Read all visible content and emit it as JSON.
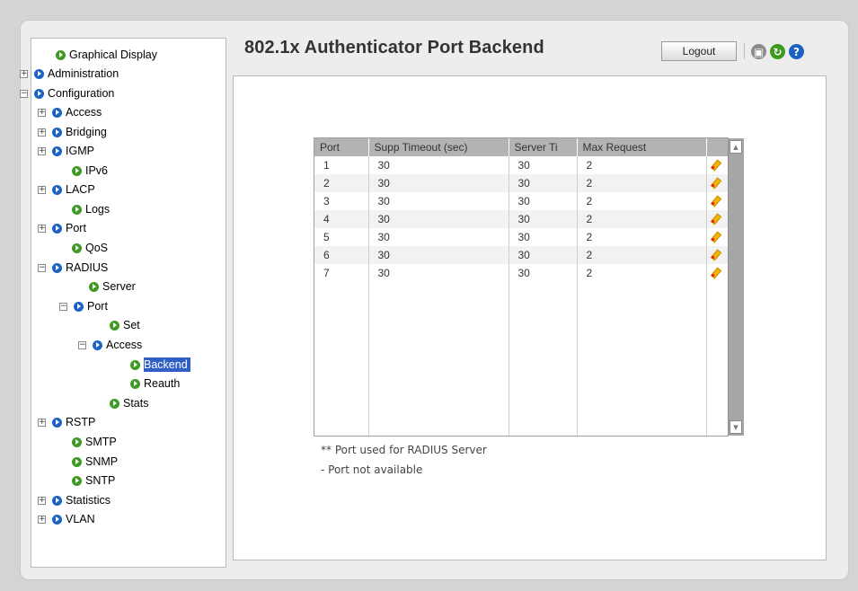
{
  "nav": {
    "items": [
      {
        "label": "Graphical Display",
        "expander": "",
        "bullet": "green"
      },
      {
        "label": "Administration",
        "expander": "+",
        "bullet": "blue"
      },
      {
        "label": "Configuration",
        "expander": "−",
        "bullet": "blue"
      },
      {
        "label": "Access",
        "expander": "+",
        "bullet": "blue"
      },
      {
        "label": "Bridging",
        "expander": "+",
        "bullet": "blue"
      },
      {
        "label": "IGMP",
        "expander": "+",
        "bullet": "blue"
      },
      {
        "label": "IPv6",
        "expander": "",
        "bullet": "green"
      },
      {
        "label": "LACP",
        "expander": "+",
        "bullet": "blue"
      },
      {
        "label": "Logs",
        "expander": "",
        "bullet": "green"
      },
      {
        "label": "Port",
        "expander": "+",
        "bullet": "blue"
      },
      {
        "label": "QoS",
        "expander": "",
        "bullet": "green"
      },
      {
        "label": "RADIUS",
        "expander": "−",
        "bullet": "blue"
      },
      {
        "label": "Server",
        "expander": "",
        "bullet": "green"
      },
      {
        "label": "Port",
        "expander": "−",
        "bullet": "blue"
      },
      {
        "label": "Set",
        "expander": "",
        "bullet": "green"
      },
      {
        "label": "Access",
        "expander": "−",
        "bullet": "blue"
      },
      {
        "label": "Backend",
        "expander": "",
        "bullet": "green",
        "selected": true
      },
      {
        "label": "Reauth",
        "expander": "",
        "bullet": "green"
      },
      {
        "label": "Stats",
        "expander": "",
        "bullet": "green"
      },
      {
        "label": "RSTP",
        "expander": "+",
        "bullet": "blue"
      },
      {
        "label": "SMTP",
        "expander": "",
        "bullet": "green"
      },
      {
        "label": "SNMP",
        "expander": "",
        "bullet": "green"
      },
      {
        "label": "SNTP",
        "expander": "",
        "bullet": "green"
      },
      {
        "label": "Statistics",
        "expander": "+",
        "bullet": "blue"
      },
      {
        "label": "VLAN",
        "expander": "+",
        "bullet": "blue"
      }
    ]
  },
  "header": {
    "title": "802.1x Authenticator Port Backend",
    "logout_label": "Logout",
    "icons": [
      "save-icon",
      "refresh-icon",
      "help-icon"
    ]
  },
  "table": {
    "columns": [
      "Port",
      "Supp Timeout (sec)",
      "Server Ti",
      "Max Request",
      ""
    ],
    "rows": [
      [
        "1",
        "30",
        "30",
        "2"
      ],
      [
        "2",
        "30",
        "30",
        "2"
      ],
      [
        "3",
        "30",
        "30",
        "2"
      ],
      [
        "4",
        "30",
        "30",
        "2"
      ],
      [
        "5",
        "30",
        "30",
        "2"
      ],
      [
        "6",
        "30",
        "30",
        "2"
      ],
      [
        "7",
        "30",
        "30",
        "2"
      ]
    ]
  },
  "notes": {
    "radius_port": "** Port used for RADIUS Server",
    "not_available": "- Port not available"
  },
  "colors": {
    "bullet_blue": "#1b62c4",
    "bullet_green": "#3f9a23",
    "selected_bg": "#2f5fc4",
    "header_bg": "#b3b3b3"
  }
}
